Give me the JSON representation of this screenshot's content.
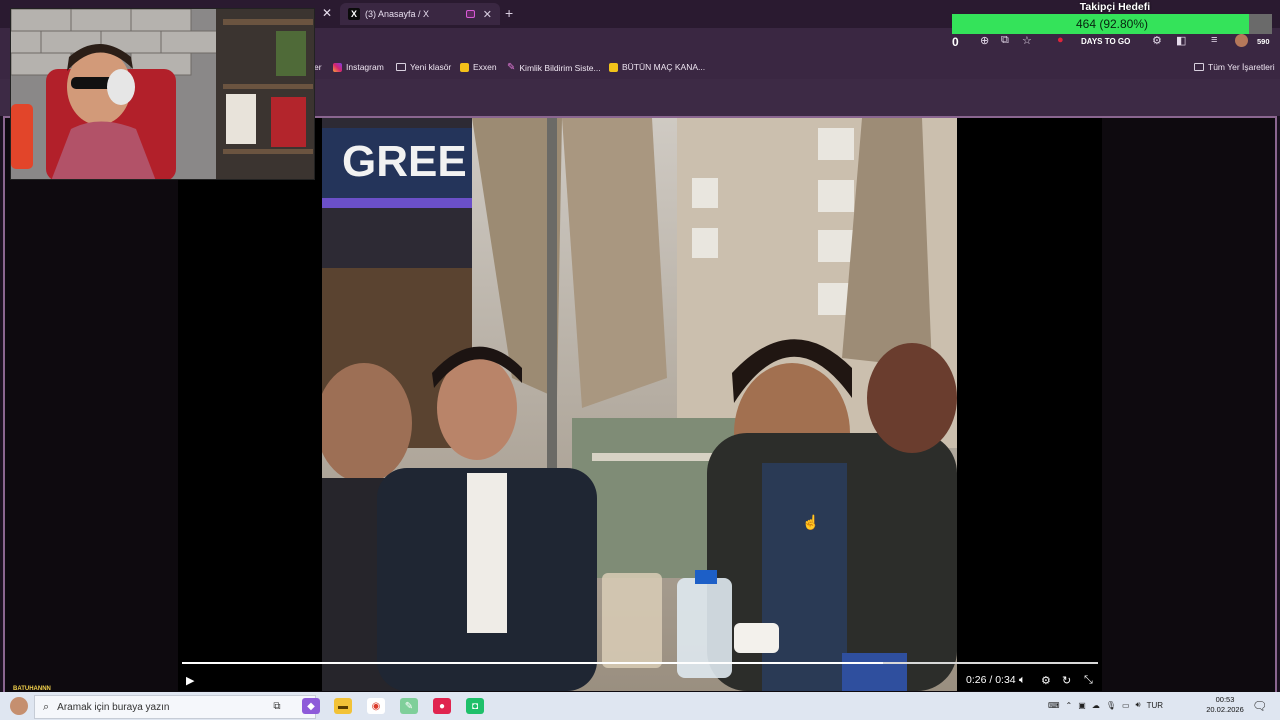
{
  "browser": {
    "active_tab_title": "(3) Anasayfa / X",
    "new_tab_symbol": "+",
    "bookmarks": [
      "Instagram",
      "Yeni klasör",
      "Exxen",
      "Kimlik Bildirim Siste...",
      "BÜTÜN MAÇ KANA..."
    ],
    "bookmarks_cut_prefix": "er",
    "all_bookmarks": "Tüm Yer İşaretleri",
    "extension_badge": "DAYS TO GO",
    "extension_count": "590"
  },
  "overlay": {
    "goal_title": "Takipçi Hedefi",
    "goal_text": "464 (92.80%)",
    "goal_fraction": 0.928,
    "goal_counter": "0",
    "streamer_label": "BATUHANNN"
  },
  "video": {
    "time": "0:26 / 0:34",
    "progress_fraction": 0.765,
    "play_icon": "play-icon",
    "volume_icon": "volume-icon",
    "settings_icon": "settings-icon"
  },
  "taskbar": {
    "search_placeholder": "Aramak için buraya yazın",
    "language": "TUR",
    "time": "00:53",
    "date": "20.02.2026"
  },
  "colors": {
    "chrome_bg": "#3a2742",
    "goal_fill": "#34e35a",
    "taskbar": "#dfe6f1"
  }
}
